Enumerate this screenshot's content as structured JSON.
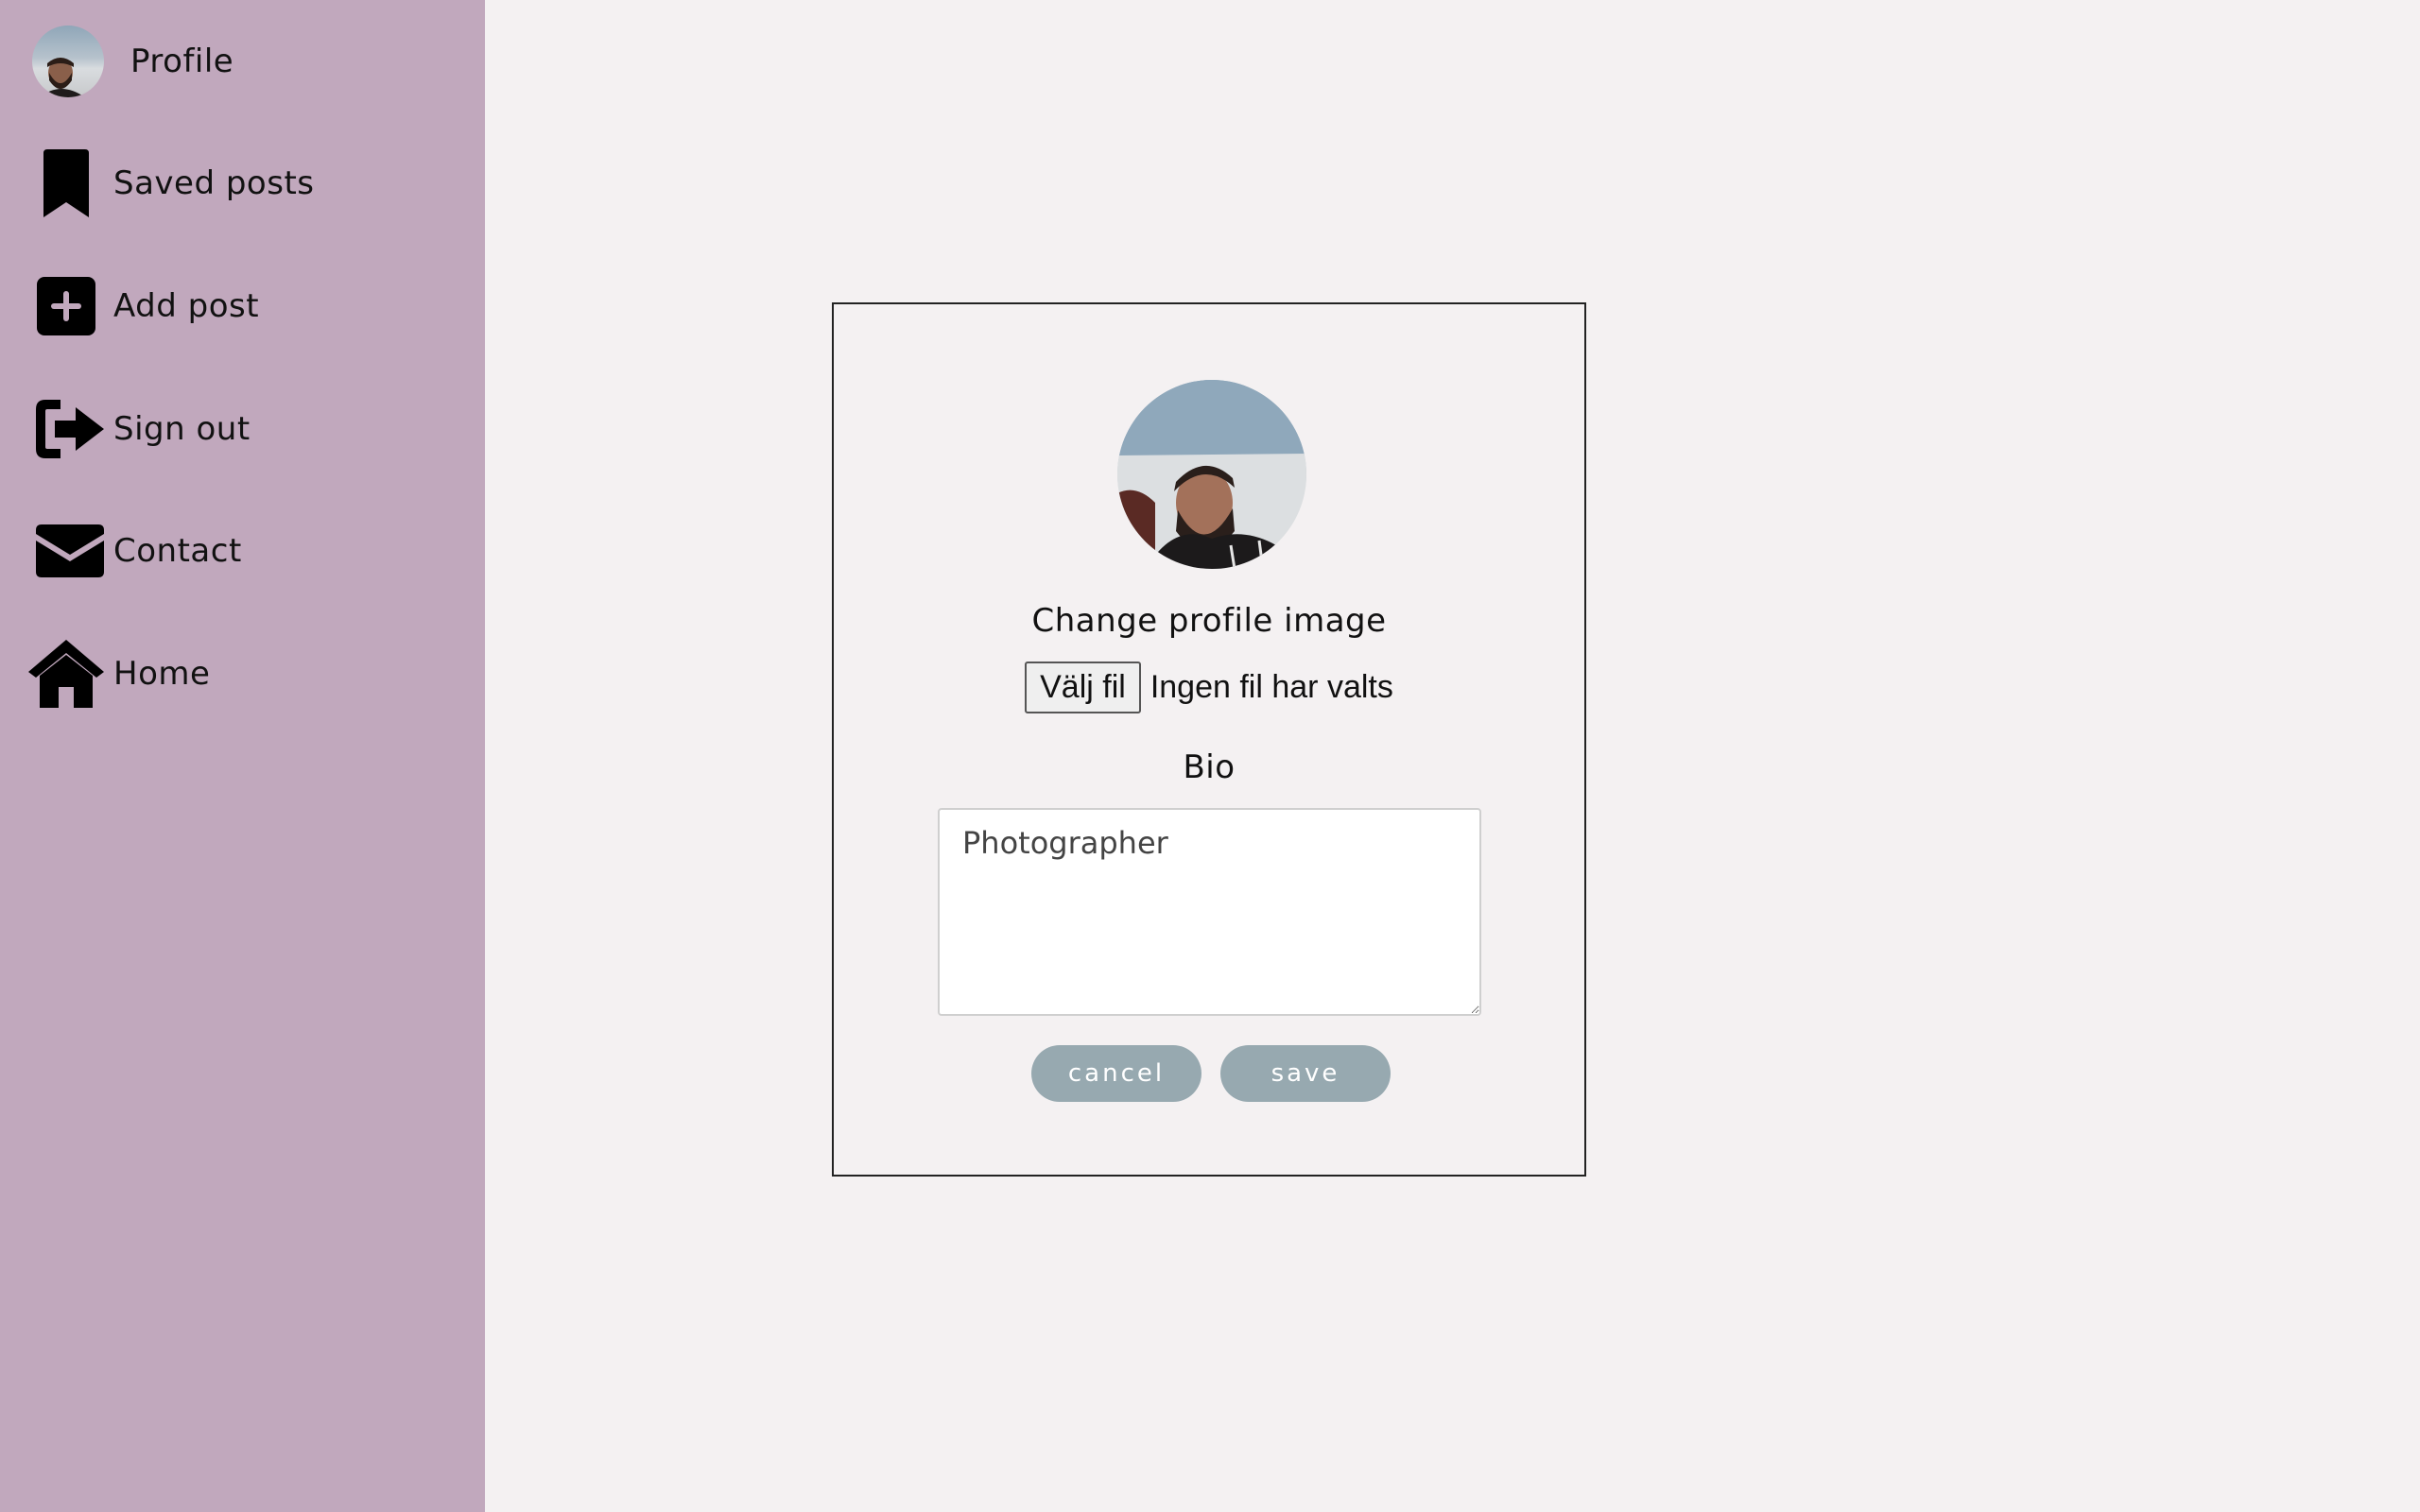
{
  "sidebar": {
    "items": [
      {
        "label": "Profile",
        "icon": "avatar"
      },
      {
        "label": "Saved posts",
        "icon": "bookmark-icon"
      },
      {
        "label": "Add post",
        "icon": "plus-square-icon"
      },
      {
        "label": "Sign out",
        "icon": "sign-out-icon"
      },
      {
        "label": "Contact",
        "icon": "envelope-icon"
      },
      {
        "label": "Home",
        "icon": "home-icon"
      }
    ]
  },
  "editor": {
    "change_image_label": "Change profile image",
    "file_button_label": "Välj fil",
    "file_status": "Ingen fil har valts",
    "bio_label": "Bio",
    "bio_value": "Photographer",
    "cancel_label": "cancel",
    "save_label": "save"
  },
  "colors": {
    "sidebar_bg": "#c1a8bd",
    "page_bg": "#f4f1f2",
    "button_bg": "#97a9b0"
  }
}
